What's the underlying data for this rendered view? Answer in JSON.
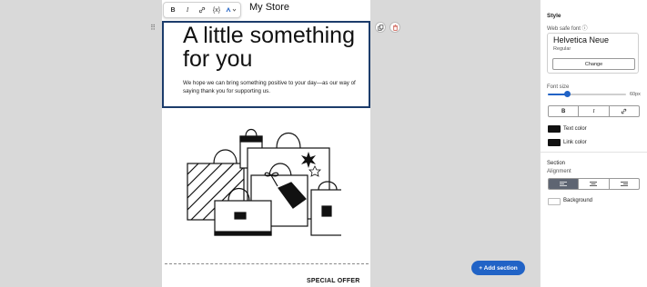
{
  "email": {
    "store_name": "My Store",
    "headline": "A little something for you",
    "body": "We hope we can bring something positive to your day—as our way of saying thank you for supporting us.",
    "special_offer": "SPECIAL OFFER"
  },
  "toolbar": {
    "bold": "B",
    "italic": "I",
    "link": "🔗",
    "variable": "{x}",
    "more": "⁂▾"
  },
  "canvas": {
    "add_section": "+ Add section"
  },
  "panel": {
    "style_heading": "Style",
    "web_safe_font_label": "Web safe font ⓘ",
    "font_name": "Helvetica Neue",
    "font_style": "Regular",
    "change_button": "Change",
    "font_size_label": "Font size",
    "font_size_value": "60px",
    "font_size_level": 0.25,
    "format_bold": "B",
    "format_italic": "I",
    "format_link": "🔗",
    "text_color_label": "Text color",
    "text_color": "#111111",
    "link_color_label": "Link color",
    "link_color": "#111111",
    "section_heading": "Section",
    "alignment_label": "Alignment",
    "align_left": "≡",
    "align_center": "≡",
    "align_right": "≡",
    "background_label": "Background",
    "background_color": "#ffffff"
  },
  "colors": {
    "accent": "#2163c6",
    "selection_border": "#1c3c6b"
  }
}
